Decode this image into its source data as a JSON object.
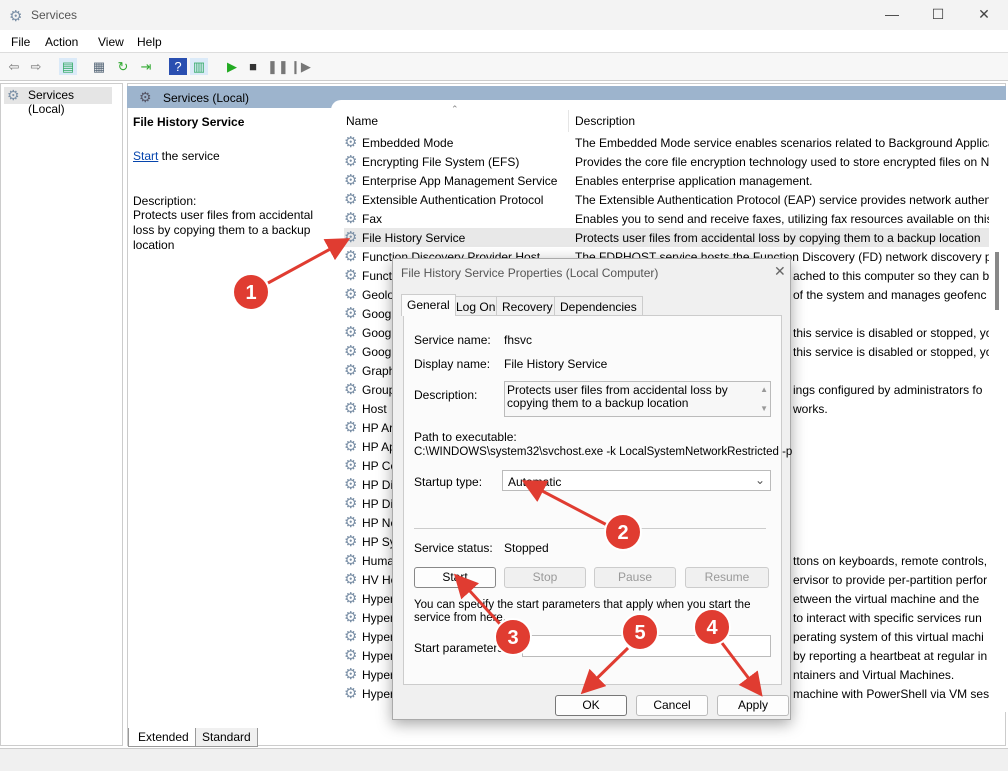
{
  "window": {
    "title": "Services",
    "min": "—",
    "max": "☐",
    "close": "✕"
  },
  "menu": [
    "File",
    "Action",
    "View",
    "Help"
  ],
  "tree": {
    "item": "Services (Local)"
  },
  "band": {
    "title": "Services (Local)"
  },
  "info": {
    "title": "File History Service",
    "start_link": "Start",
    "start_rest": " the service",
    "desc_label": "Description:",
    "desc": "Protects user files from accidental loss by copying them to a backup location"
  },
  "list": {
    "col_name": "Name",
    "col_desc": "Description",
    "rows": [
      {
        "name": "Embedded Mode",
        "desc": "The Embedded Mode service enables scenarios related to Background Applicat"
      },
      {
        "name": "Encrypting File System (EFS)",
        "desc": "Provides the core file encryption technology used to store encrypted files on N"
      },
      {
        "name": "Enterprise App Management Service",
        "desc": "Enables enterprise application management."
      },
      {
        "name": "Extensible Authentication Protocol",
        "desc": "The Extensible Authentication Protocol (EAP) service provides network authent"
      },
      {
        "name": "Fax",
        "desc": "Enables you to send and receive faxes, utilizing fax resources available on this c"
      },
      {
        "name": "File History Service",
        "desc": "Protects user files from accidental loss by copying them to a backup location",
        "selected": true
      },
      {
        "name": "Function Discovery Provider Host",
        "desc": "The FDPHOST service hosts the Function Discovery (FD) network discovery prov"
      },
      {
        "name": "Functi",
        "desc": "ached to this computer so they can b",
        "tail": true
      },
      {
        "name": "Geolo",
        "desc": "of the system and manages geofenc",
        "tail": true
      },
      {
        "name": "Goog",
        "desc": "",
        "tail": true
      },
      {
        "name": "Goog",
        "desc": "this service is disabled or stopped, yo",
        "tail": true
      },
      {
        "name": "Goog",
        "desc": "this service is disabled or stopped, yo",
        "tail": true
      },
      {
        "name": "Graph",
        "desc": "",
        "tail": true
      },
      {
        "name": "Group",
        "desc": "ings configured by administrators fo",
        "tail": true
      },
      {
        "name": "Host",
        "desc": "works.",
        "tail": true
      },
      {
        "name": "HP Ar",
        "desc": "",
        "tail": true
      },
      {
        "name": "HP Ap",
        "desc": "",
        "tail": true
      },
      {
        "name": "HP Co",
        "desc": "",
        "tail": true
      },
      {
        "name": "HP Di",
        "desc": "",
        "tail": true
      },
      {
        "name": "HP Di",
        "desc": "",
        "tail": true
      },
      {
        "name": "HP Ne",
        "desc": "",
        "tail": true
      },
      {
        "name": "HP Sy",
        "desc": "",
        "tail": true
      },
      {
        "name": "Huma",
        "desc": "ttons on keyboards, remote controls,",
        "tail": true
      },
      {
        "name": "HV Ho",
        "desc": "ervisor to provide per-partition perfor",
        "tail": true
      },
      {
        "name": "Hyper",
        "desc": "etween the virtual machine and the",
        "tail": true
      },
      {
        "name": "Hyper",
        "desc": "to interact with specific services run",
        "tail": true
      },
      {
        "name": "Hyper",
        "desc": "perating system of this virtual machi",
        "tail": true
      },
      {
        "name": "Hyper",
        "desc": "by reporting a heartbeat at regular in",
        "tail": true
      },
      {
        "name": "Hyper",
        "desc": "ntainers and Virtual Machines.",
        "tail": true
      },
      {
        "name": "Hyper",
        "desc": "machine with PowerShell via VM sess",
        "tail": true
      }
    ]
  },
  "bottom_tabs": [
    "Extended",
    "Standard"
  ],
  "dialog": {
    "title": "File History Service Properties (Local Computer)",
    "close": "✕",
    "tabs": [
      "General",
      "Log On",
      "Recovery",
      "Dependencies"
    ],
    "service_name_label": "Service name:",
    "service_name": "fhsvc",
    "display_name_label": "Display name:",
    "display_name": "File History Service",
    "description_label": "Description:",
    "description": "Protects user files from accidental loss by copying them to a backup location",
    "path_label": "Path to executable:",
    "path": "C:\\WINDOWS\\system32\\svchost.exe -k LocalSystemNetworkRestricted -p",
    "startup_label": "Startup type:",
    "startup_value": "Automatic",
    "status_label": "Service status:",
    "status_value": "Stopped",
    "buttons": {
      "start": "Start",
      "stop": "Stop",
      "pause": "Pause",
      "resume": "Resume"
    },
    "hint": "You can specify the start parameters that apply when you start the service from here.",
    "params_label": "Start parameters:",
    "params_value": "",
    "ok": "OK",
    "cancel": "Cancel",
    "apply": "Apply"
  },
  "annotations": [
    "1",
    "2",
    "3",
    "4",
    "5"
  ],
  "colors": {
    "annotation": "#e03c31",
    "band": "#9db4cd"
  }
}
